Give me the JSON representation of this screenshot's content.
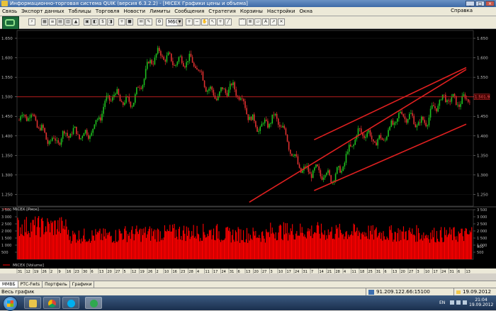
{
  "window": {
    "title": "Информационно-торговая система QUIK (версия 6.3.2.2) - [MICEX Графики цены и объема]",
    "controls": [
      "_",
      "□",
      "×"
    ]
  },
  "menu": {
    "items": [
      "Связь",
      "Экспорт данных",
      "Таблицы",
      "Торговля",
      "Новости",
      "Лимиты",
      "Сообщения",
      "Стратегия",
      "Корзины",
      "Настройки",
      "Окна"
    ],
    "help": "Справка"
  },
  "toolbar": {
    "timeframe": "M60"
  },
  "price_chart": {
    "legend": "MICEX [Риск]",
    "y_ticks": [
      "1.650",
      "1.600",
      "1.550",
      "1.500",
      "1.450",
      "1.400",
      "1.350",
      "1.300",
      "1.250"
    ],
    "current_price_label": "1.501,9",
    "horizontal_level": 1500,
    "colors": {
      "up": "#1fbf1f",
      "down": "#e03030",
      "line": "#cc2020",
      "channel": "#e02020",
      "background": "#000000",
      "grid": "#2a2a2a"
    }
  },
  "volume_chart": {
    "legend": "MICEX [Volume]",
    "left_ticks": [
      "3 500",
      "3 000",
      "2 500",
      "2 000",
      "1 500",
      "1 000",
      "500"
    ],
    "right_ticks": [
      "3 500",
      "3 000",
      "2 500",
      "2 000",
      "1 500",
      "1 000",
      "500"
    ],
    "right_marker": "900",
    "color": "#ff0000"
  },
  "time_axis": {
    "day_labels": [
      "31",
      "12",
      "19",
      "26",
      "2",
      "9",
      "16",
      "23",
      "30",
      "6",
      "13",
      "20",
      "27",
      "5",
      "12",
      "19",
      "26",
      "2",
      "10",
      "16",
      "23",
      "28",
      "4",
      "11",
      "17",
      "24",
      "31",
      "6",
      "13",
      "20",
      "27",
      "3",
      "10",
      "17",
      "24",
      "31",
      "7",
      "14",
      "21",
      "28",
      "4",
      "11",
      "18",
      "25",
      "31",
      "6",
      "13",
      "20",
      "27",
      "3",
      "10",
      "17",
      "24",
      "31",
      "6",
      "13"
    ],
    "month_labels": [
      "011",
      "Dec",
      "2012",
      "Feb",
      "Mar",
      "Apr",
      "May",
      "Jun",
      "Jul",
      "Aug",
      "Sep"
    ]
  },
  "bottom_tabs": [
    "ММВБ",
    "РТС-Fwts",
    "Портфель",
    "Графики"
  ],
  "status": {
    "left": "Весь график",
    "connection": "91.209.122.66:15100",
    "date": "19.09.2012"
  },
  "taskbar": {
    "apps": [
      "windows-explorer",
      "chrome",
      "skype",
      "quik"
    ],
    "lang": "EN",
    "time": "21:04",
    "date": "19.09.2012"
  },
  "chart_data": [
    {
      "type": "candlestick",
      "title": "MICEX [Риск]",
      "y_range": [
        1220,
        1670
      ],
      "x": [
        "Dec 2011",
        "Jan 2012",
        "Feb",
        "Mar",
        "Apr",
        "May",
        "Jun",
        "Jul",
        "Aug",
        "Sep"
      ],
      "series": [
        {
          "name": "MICEX",
          "values": [
            1440,
            1390,
            1490,
            1610,
            1520,
            1430,
            1290,
            1400,
            1450,
            1510
          ]
        }
      ],
      "channel_lines": [
        {
          "from": [
            "May",
            1230
          ],
          "to": [
            "Sep",
            1570
          ]
        },
        {
          "from": [
            "Jun",
            1260
          ],
          "to": [
            "Sep",
            1430
          ]
        },
        {
          "from": [
            "Jun",
            1390
          ],
          "to": [
            "Sep",
            1575
          ]
        }
      ],
      "horizontal_line": 1500
    },
    {
      "type": "bar",
      "title": "MICEX [Volume]",
      "y_range": [
        0,
        3500
      ],
      "x": [
        "Dec 2011",
        "Jan 2012",
        "Feb",
        "Mar",
        "Apr",
        "May",
        "Jun",
        "Jul",
        "Aug",
        "Sep"
      ],
      "values": [
        2800,
        2000,
        2200,
        2300,
        2100,
        2400,
        2300,
        2200,
        2100,
        2700
      ]
    }
  ]
}
